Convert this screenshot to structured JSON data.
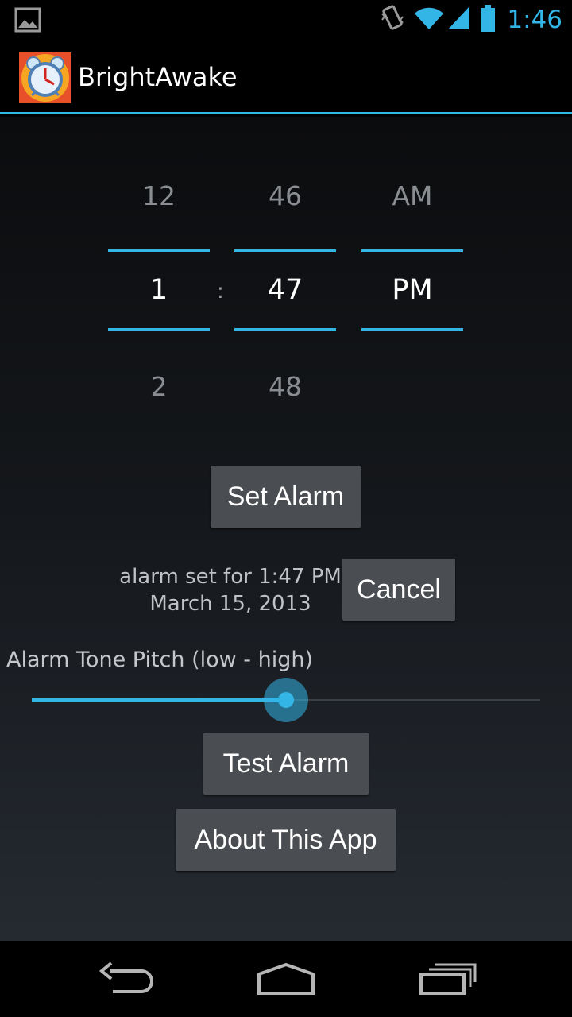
{
  "status_bar": {
    "time": "1:46",
    "icons": [
      "image-notification-icon",
      "vibrate-icon",
      "wifi-icon",
      "cell-signal-icon",
      "battery-icon"
    ]
  },
  "action_bar": {
    "title": "BrightAwake",
    "icon": "alarm-clock-app-icon"
  },
  "time_picker": {
    "hour": {
      "above": "12",
      "selected": "1",
      "below": "2"
    },
    "minute": {
      "above": "46",
      "selected": "47",
      "below": "48"
    },
    "ampm": {
      "above": "AM",
      "selected": "PM"
    },
    "separator": ":"
  },
  "buttons": {
    "set_alarm": "Set Alarm",
    "cancel": "Cancel",
    "test_alarm": "Test Alarm",
    "about": "About This App"
  },
  "alarm_status": {
    "line1": "alarm set for 1:47 PM",
    "line2": "March 15, 2013"
  },
  "pitch": {
    "label": "Alarm Tone Pitch (low - high)",
    "value": 0.5
  },
  "nav_bar": {
    "icons": [
      "back-icon",
      "home-icon",
      "recents-icon"
    ]
  },
  "colors": {
    "accent": "#33b5e5",
    "button_bg": "#4a4d52"
  }
}
